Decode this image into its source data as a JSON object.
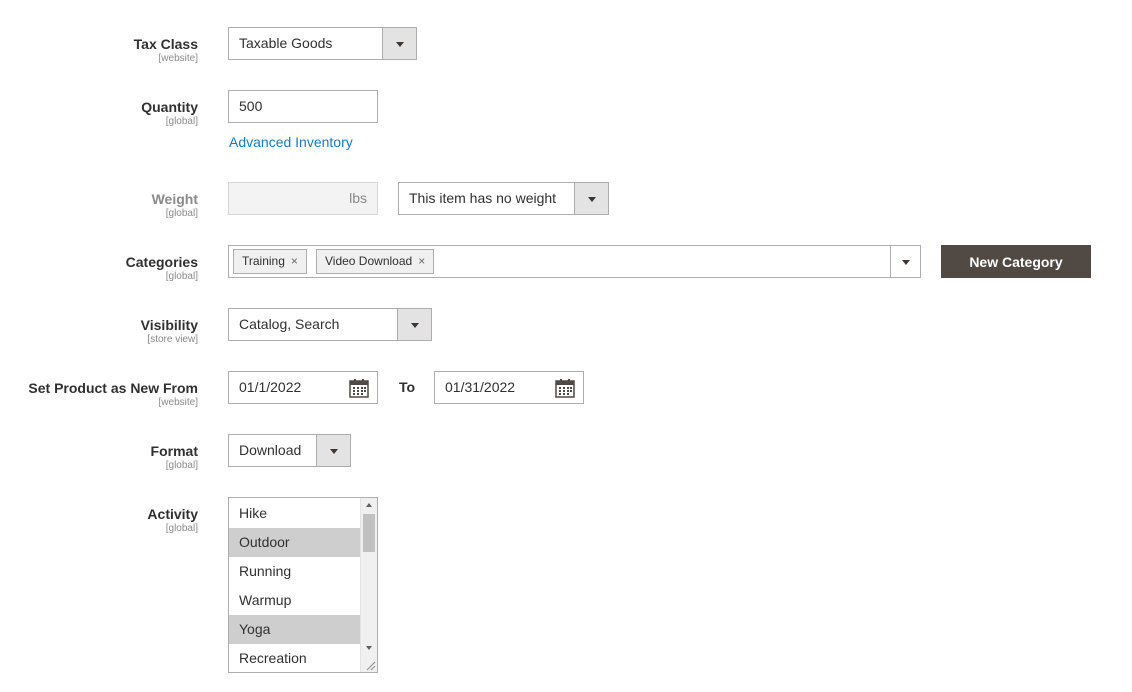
{
  "tax_class": {
    "label": "Tax Class",
    "scope": "[website]",
    "value": "Taxable Goods"
  },
  "quantity": {
    "label": "Quantity",
    "scope": "[global]",
    "value": "500",
    "link": "Advanced Inventory"
  },
  "weight": {
    "label": "Weight",
    "scope": "[global]",
    "value": "",
    "unit": "lbs",
    "option": "This item has no weight"
  },
  "categories": {
    "label": "Categories",
    "scope": "[global]",
    "chips": [
      "Training",
      "Video Download"
    ],
    "remove_glyph": "×",
    "new_button": "New Category"
  },
  "visibility": {
    "label": "Visibility",
    "scope": "[store view]",
    "value": "Catalog, Search"
  },
  "new_from": {
    "label": "Set Product as New From",
    "scope": "[website]",
    "from": "01/1/2022",
    "to_label": "To",
    "to": "01/31/2022"
  },
  "format": {
    "label": "Format",
    "scope": "[global]",
    "value": "Download"
  },
  "activity": {
    "label": "Activity",
    "scope": "[global]",
    "options": [
      {
        "label": "Hike",
        "selected": false
      },
      {
        "label": "Outdoor",
        "selected": true
      },
      {
        "label": "Running",
        "selected": false
      },
      {
        "label": "Warmup",
        "selected": false
      },
      {
        "label": "Yoga",
        "selected": true
      },
      {
        "label": "Recreation",
        "selected": false
      }
    ]
  },
  "colors": {
    "link": "#1979c3",
    "button_dark": "#514943",
    "selected_option": "#cecece"
  }
}
